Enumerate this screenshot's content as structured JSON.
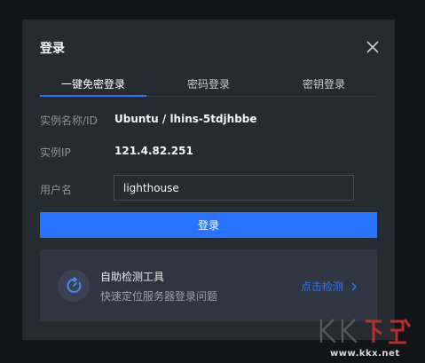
{
  "dialog": {
    "title": "登录"
  },
  "tabs": [
    {
      "label": "一键免密登录",
      "active": true
    },
    {
      "label": "密码登录",
      "active": false
    },
    {
      "label": "密钥登录",
      "active": false
    }
  ],
  "instance": {
    "name_label": "实例名称/ID",
    "name_value": "Ubuntu / lhins-5tdjhbbe",
    "ip_label": "实例IP",
    "ip_value": "121.4.82.251",
    "user_label": "用户名",
    "user_value": "lighthouse"
  },
  "login_button": "登录",
  "tool": {
    "title": "自助检测工具",
    "desc": "快速定位服务器登录问题",
    "link": "点击检测"
  },
  "watermark": {
    "logo": "KK下载",
    "url": "www.kkx.net"
  },
  "colors": {
    "accent": "#2a73ff",
    "dialog_bg": "#262a31",
    "card_bg": "#303641"
  },
  "icons": {
    "close": "close-icon",
    "tool": "refresh-gauge-icon",
    "chevron": "chevron-right-icon"
  }
}
